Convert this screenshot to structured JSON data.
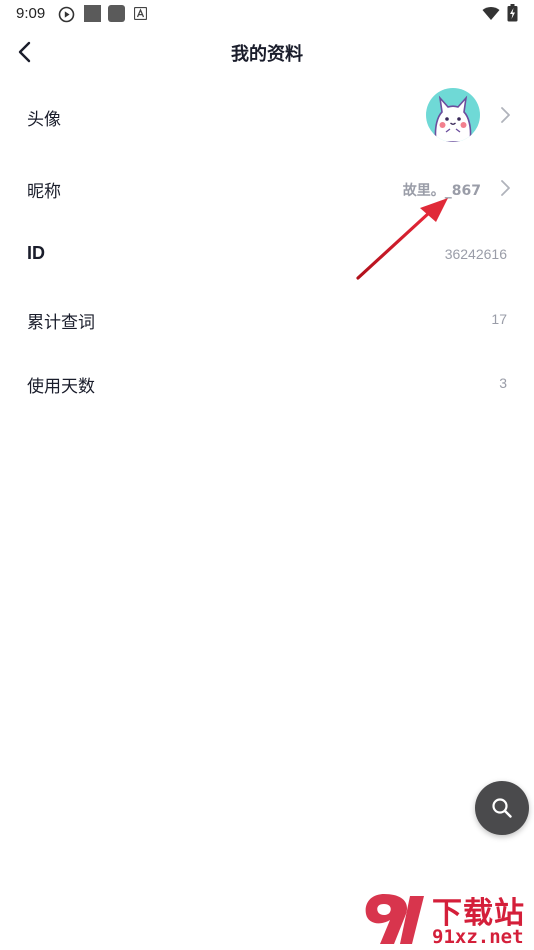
{
  "status_bar": {
    "time": "9:09"
  },
  "header": {
    "title": "我的资料"
  },
  "rows": {
    "avatar": {
      "label": "头像"
    },
    "nickname": {
      "label": "昵称",
      "value": "故里。_867"
    },
    "id": {
      "label": "ID",
      "value": "36242616"
    },
    "total_queries": {
      "label": "累计查词",
      "value": "17"
    },
    "days_used": {
      "label": "使用天数",
      "value": "3"
    }
  },
  "watermark": {
    "top": "下载站",
    "bottom": "91xz.net"
  },
  "colors": {
    "accent_red": "#d41f3a",
    "fab_bg": "#4a4a4c",
    "avatar_bg": "#6fd9d6",
    "value_gray": "#9a9da8"
  }
}
